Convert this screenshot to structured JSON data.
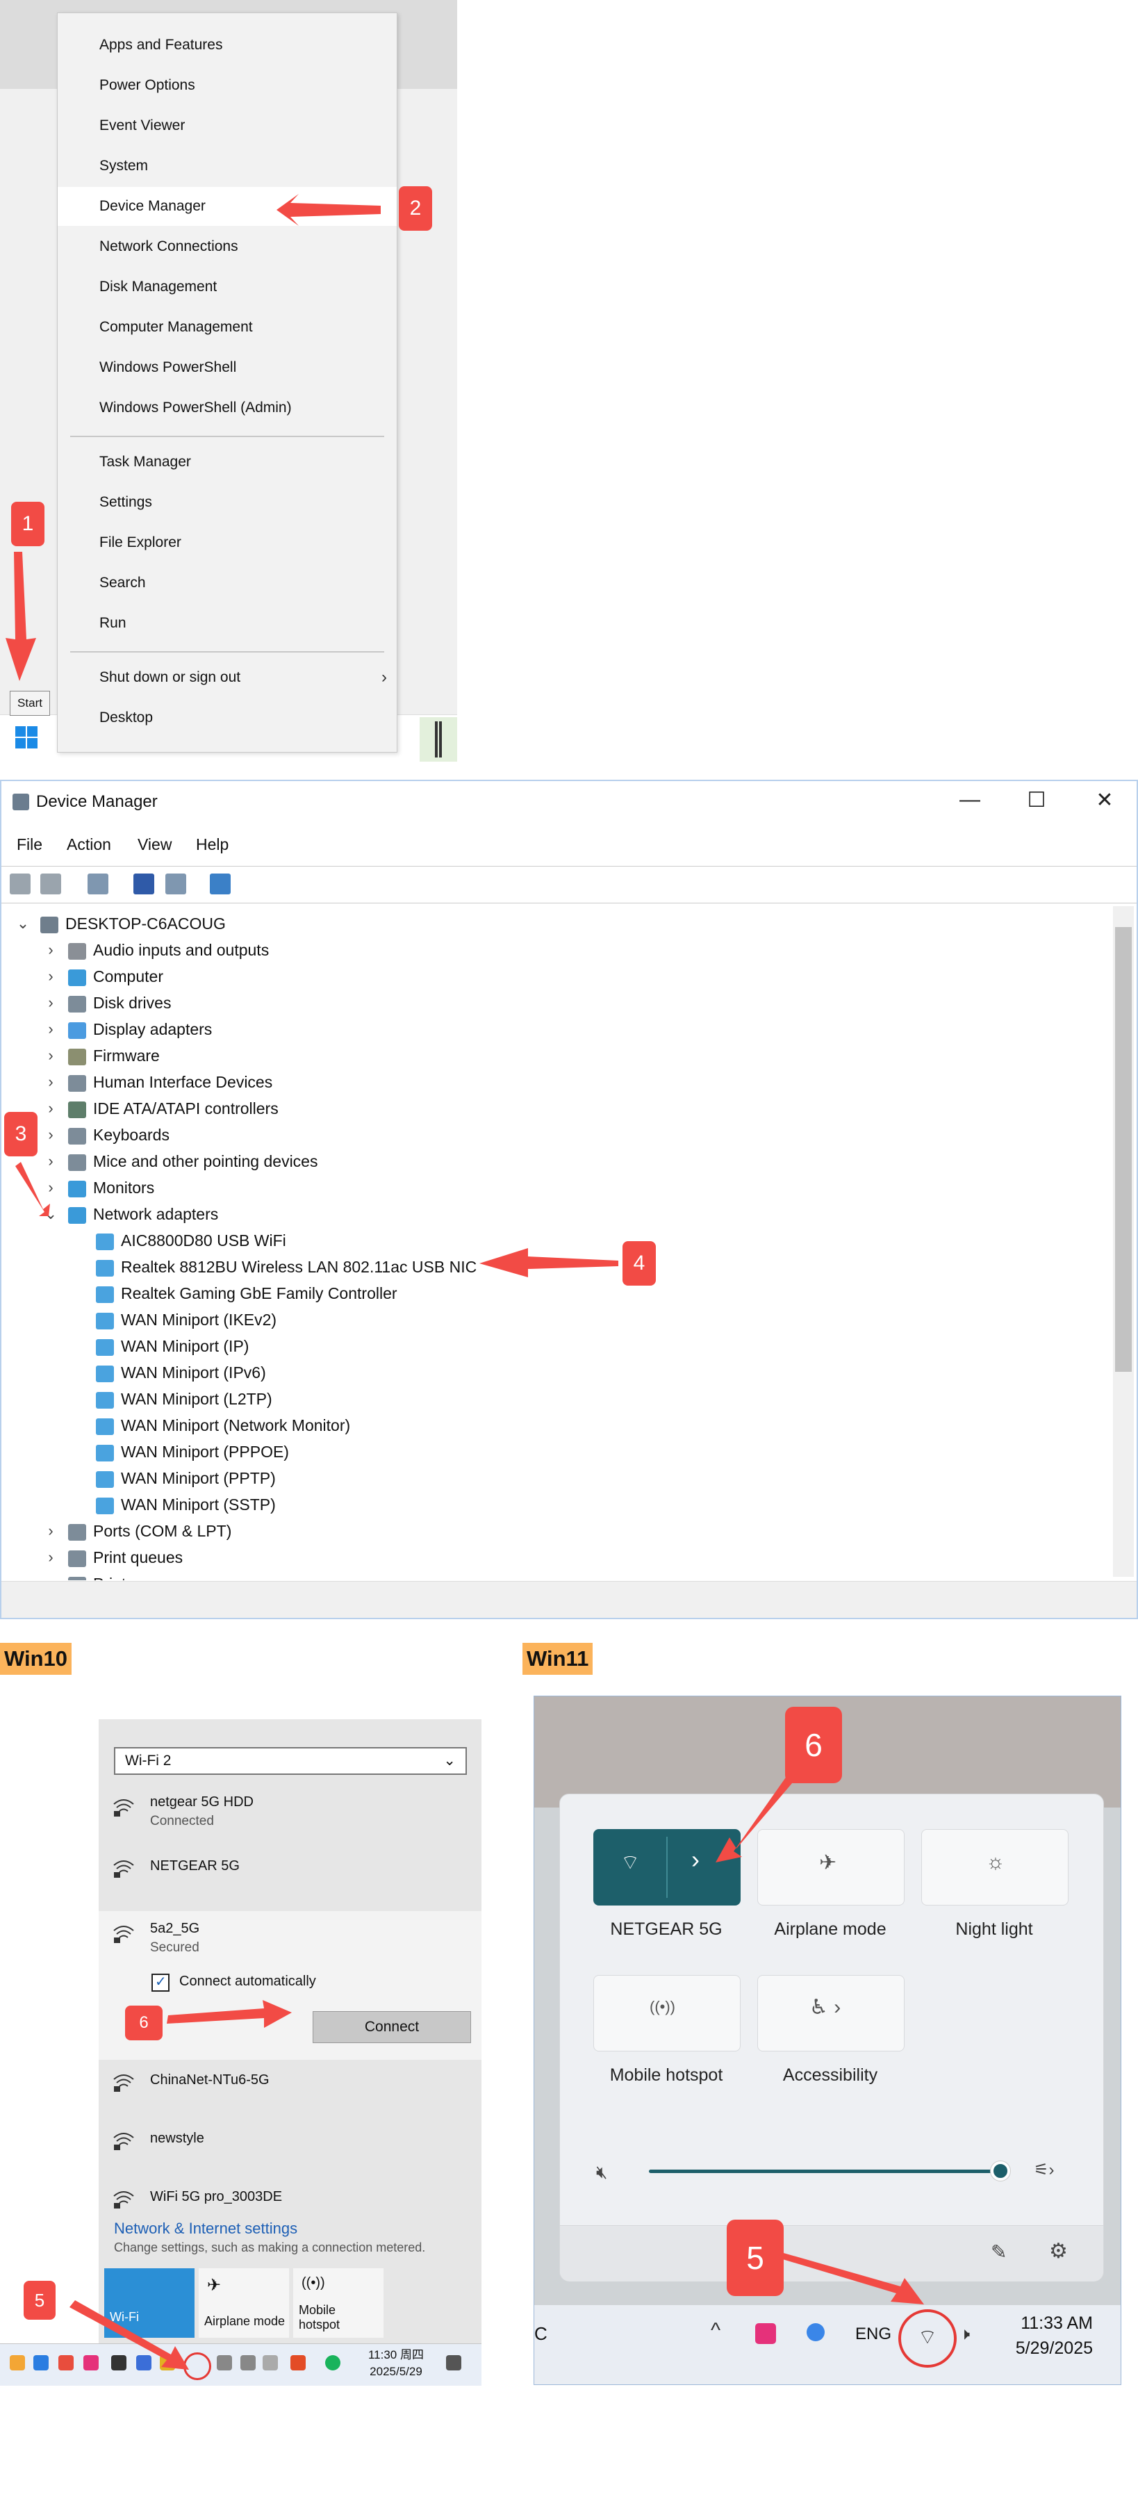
{
  "winx_menu": {
    "items": [
      "Apps and Features",
      "Power Options",
      "Event Viewer",
      "System",
      "Device Manager",
      "Network Connections",
      "Disk Management",
      "Computer Management",
      "Windows PowerShell",
      "Windows PowerShell (Admin)",
      "Task Manager",
      "Settings",
      "File Explorer",
      "Search",
      "Run",
      "Shut down or sign out",
      "Desktop"
    ],
    "highlighted": "Device Manager",
    "start_tooltip": "Start"
  },
  "badges": {
    "b1": "1",
    "b2": "2",
    "b3": "3",
    "b4": "4",
    "b5a": "5",
    "b6a": "6",
    "b5b": "5",
    "b6b": "6"
  },
  "device_manager": {
    "title": "Device Manager",
    "window_controls": {
      "minimize": "—",
      "maximize": "☐",
      "close": "✕"
    },
    "menu": [
      "File",
      "Action",
      "View",
      "Help"
    ],
    "root": "DESKTOP-C6ACOUG",
    "categories": [
      "Audio inputs and outputs",
      "Computer",
      "Disk drives",
      "Display adapters",
      "Firmware",
      "Human Interface Devices",
      "IDE ATA/ATAPI controllers",
      "Keyboards",
      "Mice and other pointing devices",
      "Monitors",
      "Network adapters"
    ],
    "network_adapters": [
      "AIC8800D80 USB WiFi",
      "Realtek 8812BU Wireless LAN 802.11ac USB NIC",
      "Realtek Gaming GbE Family Controller",
      "WAN Miniport (IKEv2)",
      "WAN Miniport (IP)",
      "WAN Miniport (IPv6)",
      "WAN Miniport (L2TP)",
      "WAN Miniport (Network Monitor)",
      "WAN Miniport (PPPOE)",
      "WAN Miniport (PPTP)",
      "WAN Miniport (SSTP)"
    ],
    "after": [
      "Ports (COM & LPT)",
      "Print queues",
      "Printers"
    ]
  },
  "labels": {
    "win10": "Win10",
    "win11": "Win11"
  },
  "win10": {
    "adapter_select": "Wi-Fi 2",
    "networks": [
      {
        "name": "netgear 5G HDD",
        "status": "Connected"
      },
      {
        "name": "NETGEAR 5G",
        "status": ""
      },
      {
        "name": "5a2_5G",
        "status": "Secured"
      },
      {
        "name": "ChinaNet-NTu6-5G",
        "status": ""
      },
      {
        "name": "newstyle",
        "status": ""
      },
      {
        "name": "WiFi 5G pro_3003DE",
        "status": ""
      }
    ],
    "connect_auto": "Connect automatically",
    "connect_button": "Connect",
    "settings_link": "Network & Internet settings",
    "settings_desc": "Change settings, such as making a connection metered.",
    "tiles": [
      "Wi-Fi",
      "Airplane mode",
      "Mobile hotspot"
    ],
    "clock_time": "11:30 周四",
    "clock_date": "2025/5/29"
  },
  "win11": {
    "tiles": [
      "NETGEAR 5G",
      "Airplane mode",
      "Night light",
      "Mobile hotspot",
      "Accessibility"
    ],
    "tray_lang": "ENG",
    "clock_time": "11:33 AM",
    "clock_date": "5/29/2025",
    "taskbar_left": "C"
  },
  "colors": {
    "badge": "#f24b45",
    "accent": "#1a8ae6",
    "win11_accent": "#1d5f6a",
    "win_label": "#fbb35b"
  }
}
